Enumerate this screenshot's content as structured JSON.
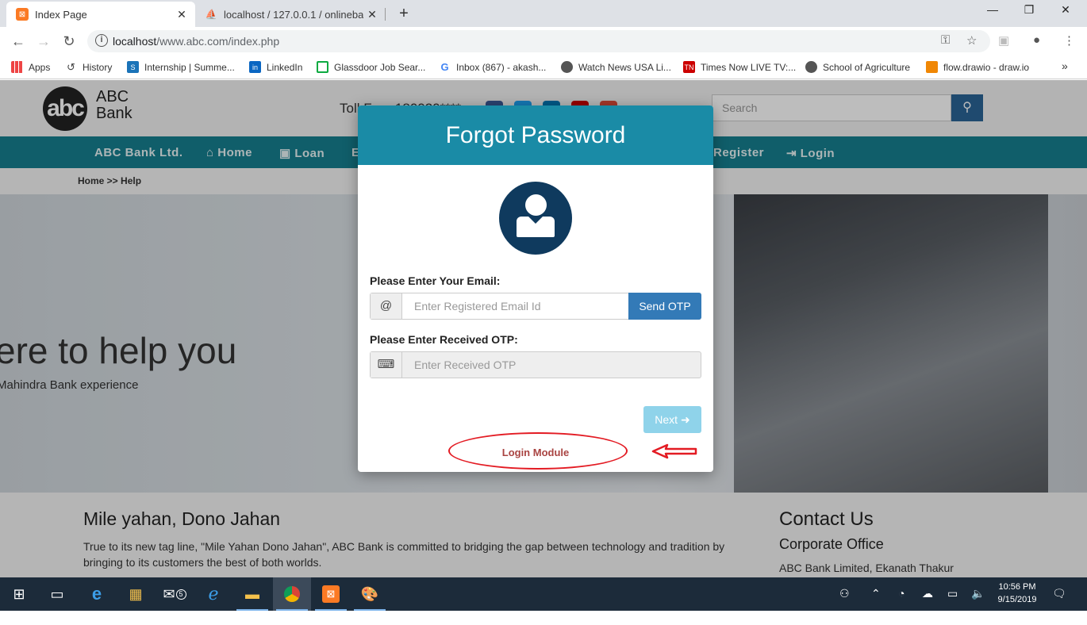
{
  "browser": {
    "tabs": [
      {
        "title": "Index Page",
        "active": true,
        "favicon": "xampp-icon"
      },
      {
        "title": "localhost / 127.0.0.1 / onlinebank",
        "active": false,
        "favicon": "phpmyadmin-icon"
      }
    ],
    "url_host": "localhost",
    "url_path": "/www.abc.com/index.php",
    "bookmarks": [
      {
        "label": "Apps",
        "icon": "apps-grid-icon"
      },
      {
        "label": "History",
        "icon": "history-icon"
      },
      {
        "label": "Internship | Summe...",
        "icon": "internshala-icon"
      },
      {
        "label": "LinkedIn",
        "icon": "linkedin-icon"
      },
      {
        "label": "Glassdoor Job Sear...",
        "icon": "glassdoor-icon"
      },
      {
        "label": "Inbox (867) - akash...",
        "icon": "google-icon"
      },
      {
        "label": "Watch News USA Li...",
        "icon": "globe-icon"
      },
      {
        "label": "Times Now LIVE TV:...",
        "icon": "timesnow-icon"
      },
      {
        "label": "School of Agriculture",
        "icon": "globe-icon"
      },
      {
        "label": "flow.drawio - draw.io",
        "icon": "drawio-icon"
      }
    ],
    "more_bookmarks": "»"
  },
  "site": {
    "logo_mark": "abc",
    "logo_line1": "ABC",
    "logo_line2": "Bank",
    "toll_free": "Toll Free 180020****",
    "search_placeholder": "Search",
    "nav": [
      "ABC Bank Ltd.",
      "Home",
      "Loan",
      "E",
      "Register",
      "Login"
    ],
    "breadcrumb": "Home >> Help",
    "hero_title": "ere to help you",
    "hero_subtitle": "Mahindra Bank experience",
    "info_title": "Mile yahan, Dono Jahan",
    "info_text": "True to its new tag line, \"Mile Yahan Dono Jahan\", ABC Bank is committed to bridging the gap between technology and tradition by bringing to its customers the best of both worlds.",
    "contact_title": "Contact Us",
    "contact_subtitle": "Corporate Office",
    "contact_address": "ABC Bank Limited, Ekanath Thakur"
  },
  "modal": {
    "title": "Forgot Password",
    "email_label": "Please Enter Your Email:",
    "email_addon": "@",
    "email_placeholder": "Enter Registered Email Id",
    "send_otp": "Send OTP",
    "otp_label": "Please Enter Received OTP:",
    "otp_placeholder": "Enter Received OTP",
    "next": "Next",
    "login_link": "Login Module"
  },
  "taskbar": {
    "time": "10:56 PM",
    "date": "9/15/2019",
    "mail_badge": "5"
  },
  "colors": {
    "header_teal": "#1a8ba6",
    "nav_teal": "#167f8f",
    "primary_blue": "#337ab7",
    "annotation_red": "#e31b23"
  }
}
